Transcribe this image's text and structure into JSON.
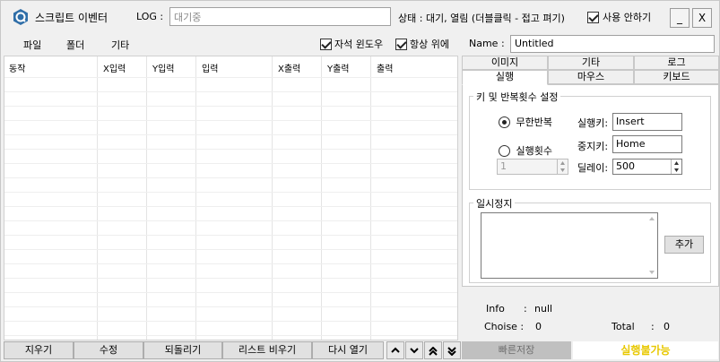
{
  "titlebar": {
    "title": "스크립트 이벤터",
    "log_label": "LOG :",
    "log_value": "대기중",
    "status": "상태 : 대기, 열림 (더블클릭 - 접고 펴기)",
    "never_use_label": "사용 안하기",
    "never_use_checked": true,
    "minimize": "_",
    "close": "X"
  },
  "menu": {
    "items": [
      "파일",
      "폴더",
      "기타"
    ],
    "magnet_window_label": "자석 윈도우",
    "always_on_top_label": "항상 위에",
    "name_label": "Name :",
    "name_value": "Untitled"
  },
  "table": {
    "headers": [
      "동작",
      "X입력",
      "Y입력",
      "입력",
      "X출력",
      "Y출력",
      "출력"
    ]
  },
  "bottom_buttons": {
    "delete": "지우기",
    "edit": "수정",
    "undo": "되돌리기",
    "clear_list": "리스트 비우기",
    "reopen": "다시 열기"
  },
  "tabs": {
    "row1": [
      "이미지",
      "기타",
      "로그"
    ],
    "row2": [
      "실행",
      "마우스",
      "키보드"
    ],
    "active": "실행"
  },
  "run_tab": {
    "group_title": "키 및 반복횟수 설정",
    "infinite_label": "무한반복",
    "count_label": "실행횟수",
    "count_value": "1",
    "run_key_label": "실행키:",
    "run_key_value": "Insert",
    "stop_key_label": "중지키:",
    "stop_key_value": "Home",
    "delay_label": "딜레이:",
    "delay_value": "500",
    "pause_title": "일시정지",
    "add_label": "추가"
  },
  "info": {
    "info_label": "Info",
    "info_value": "null",
    "choise_label": "Choise :",
    "choise_value": "0",
    "total_label": "Total",
    "total_value": "0",
    "colon": ":"
  },
  "footer": {
    "quick_save": "빠른저장",
    "run_status": "실행불가능"
  },
  "colors": {
    "run_status_text": "#e8c800",
    "app_icon": "#2f6ea8"
  }
}
